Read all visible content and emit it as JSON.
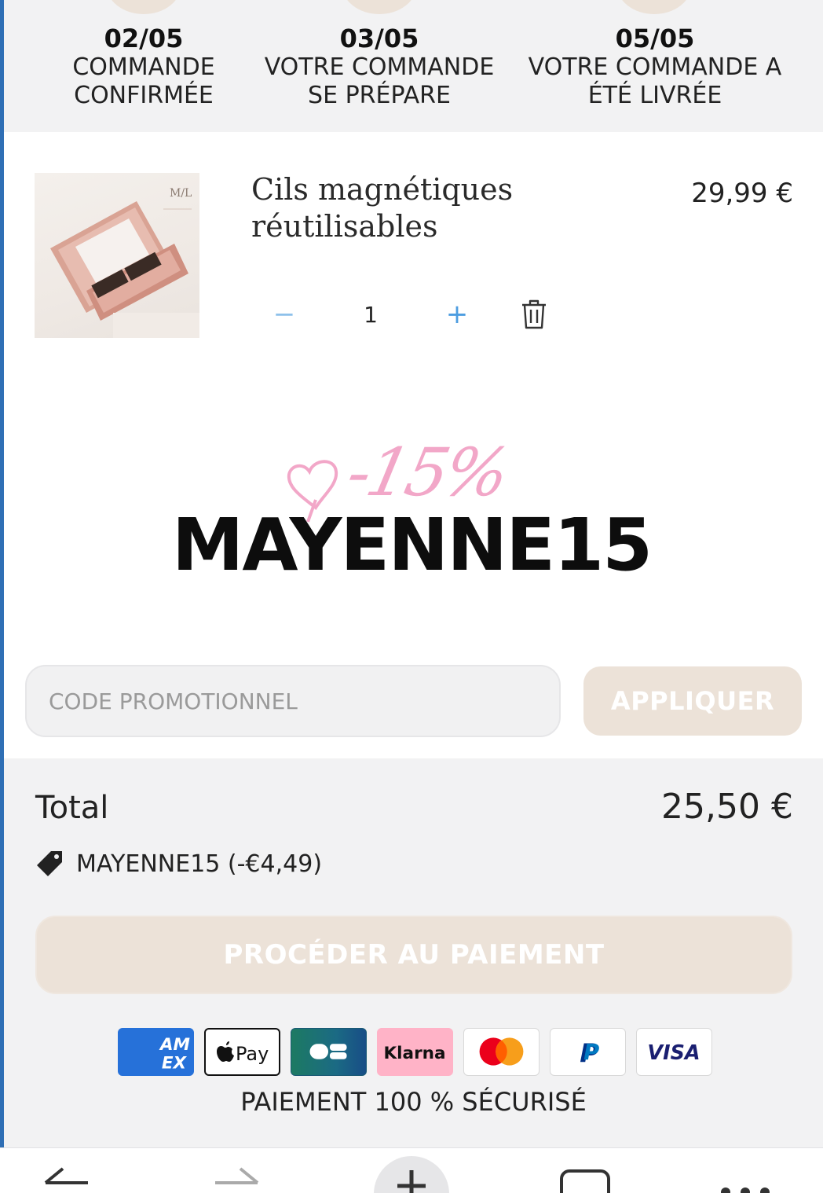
{
  "timeline": {
    "steps": [
      {
        "date": "02/05",
        "label_line1": "COMMANDE",
        "label_line2": "CONFIRMÉE"
      },
      {
        "date": "03/05",
        "label_line1": "VOTRE COMMANDE",
        "label_line2": "SE PRÉPARE"
      },
      {
        "date": "05/05",
        "label_line1": "VOTRE COMMANDE A",
        "label_line2": "ÉTÉ LIVRÉE"
      }
    ]
  },
  "product": {
    "title": "Cils magnétiques réutilisables",
    "price": "29,99 €",
    "quantity": "1",
    "minus_label": "−",
    "plus_label": "+",
    "brand_mark": "M/L"
  },
  "promo_graphic": {
    "discount": "-15%",
    "code": "MAYENNE15"
  },
  "promo_form": {
    "placeholder": "CODE PROMOTIONNEL",
    "apply_label": "APPLIQUER"
  },
  "summary": {
    "total_label": "Total",
    "total_value": "25,50 €",
    "discount_line": "MAYENNE15 (-€4,49)",
    "checkout_label": "PROCÉDER AU PAIEMENT",
    "secure_text": "PAIEMENT 100 % SÉCURISÉ"
  },
  "payment_methods": [
    {
      "name": "amex",
      "label": "AM EX"
    },
    {
      "name": "apple-pay",
      "label": "Pay"
    },
    {
      "name": "cb",
      "label": "CB"
    },
    {
      "name": "klarna",
      "label": "Klarna"
    },
    {
      "name": "mastercard",
      "label": ""
    },
    {
      "name": "paypal",
      "label": "P"
    },
    {
      "name": "visa",
      "label": "VISA"
    }
  ],
  "colors": {
    "accent_beige": "#ece2d8",
    "link_blue": "#4d9de0",
    "promo_pink": "#f2a7c8",
    "background_grey": "#f2f2f3"
  }
}
